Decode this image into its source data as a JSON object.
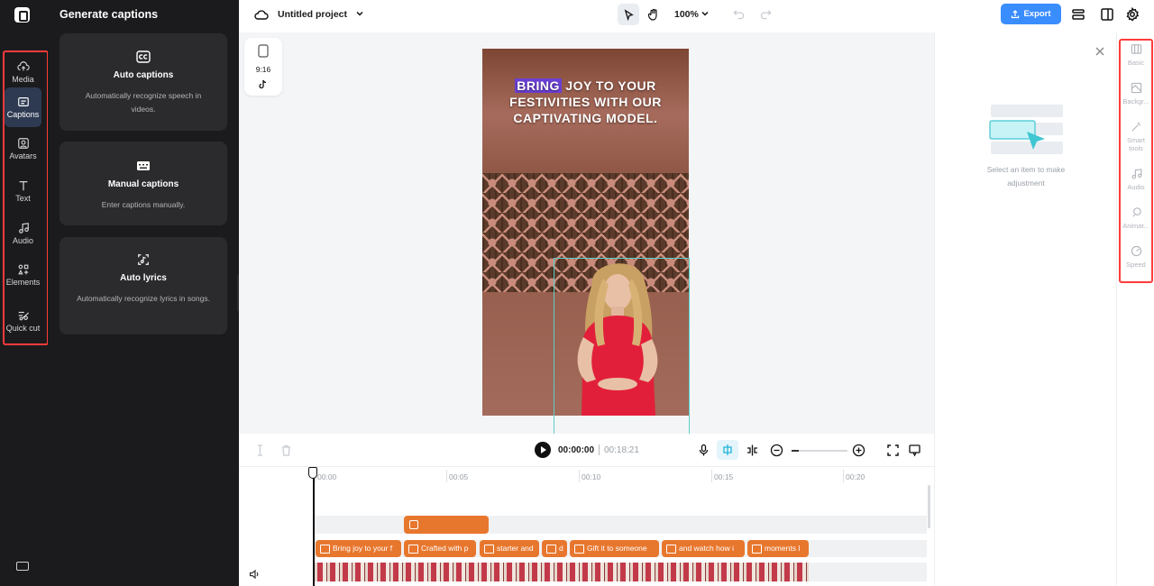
{
  "rail": {
    "items": [
      {
        "label": "Media",
        "icon": "cloud-upload-icon"
      },
      {
        "label": "Captions",
        "icon": "captions-icon"
      },
      {
        "label": "Avatars",
        "icon": "avatar-icon"
      },
      {
        "label": "Text",
        "icon": "text-icon"
      },
      {
        "label": "Audio",
        "icon": "music-note-icon"
      },
      {
        "label": "Elements",
        "icon": "elements-icon"
      },
      {
        "label": "Quick cut",
        "icon": "scissors-icon"
      }
    ],
    "active": "Captions"
  },
  "panel": {
    "title": "Generate captions",
    "cards": [
      {
        "title": "Auto captions",
        "desc": "Automatically recognize speech in videos.",
        "icon": "cc-icon"
      },
      {
        "title": "Manual captions",
        "desc": "Enter captions manually.",
        "icon": "keyboard-icon"
      },
      {
        "title": "Auto lyrics",
        "desc": "Automatically recognize lyrics in songs.",
        "icon": "lyrics-icon"
      }
    ]
  },
  "topbar": {
    "project_title": "Untitled project",
    "zoom": "100%",
    "export_label": "Export"
  },
  "canvas": {
    "ratio": "9:16",
    "caption_highlight": "BRING",
    "caption_rest": " JOY TO YOUR FESTIVITIES WITH OUR CAPTIVATING MODEL."
  },
  "prop_panel": {
    "hint": "Select an item to make adjustment"
  },
  "right_rail": {
    "items": [
      {
        "label": "Basic",
        "icon": "basic-icon"
      },
      {
        "label": "Backgr...",
        "icon": "background-icon"
      },
      {
        "label": "Smart tools",
        "icon": "magic-wand-icon"
      },
      {
        "label": "Audio",
        "icon": "music-note-icon"
      },
      {
        "label": "Animat...",
        "icon": "animation-icon"
      },
      {
        "label": "Speed",
        "icon": "speed-icon"
      }
    ]
  },
  "timeline": {
    "current_time": "00:00:00",
    "total_time": "00:18:21",
    "ruler": [
      "00:00",
      "00:05",
      "00:10",
      "00:15",
      "00:20"
    ],
    "caption_clips": [
      "Bring joy to your f",
      "Crafted with p",
      "starter and",
      "d",
      "Gift it to someone",
      "and watch how i",
      "moments l"
    ]
  },
  "colors": {
    "accent": "#3a8dff",
    "clip": "#e8772e",
    "dark_bg": "#1b1b1d",
    "highlight": "#ff3b3b"
  }
}
